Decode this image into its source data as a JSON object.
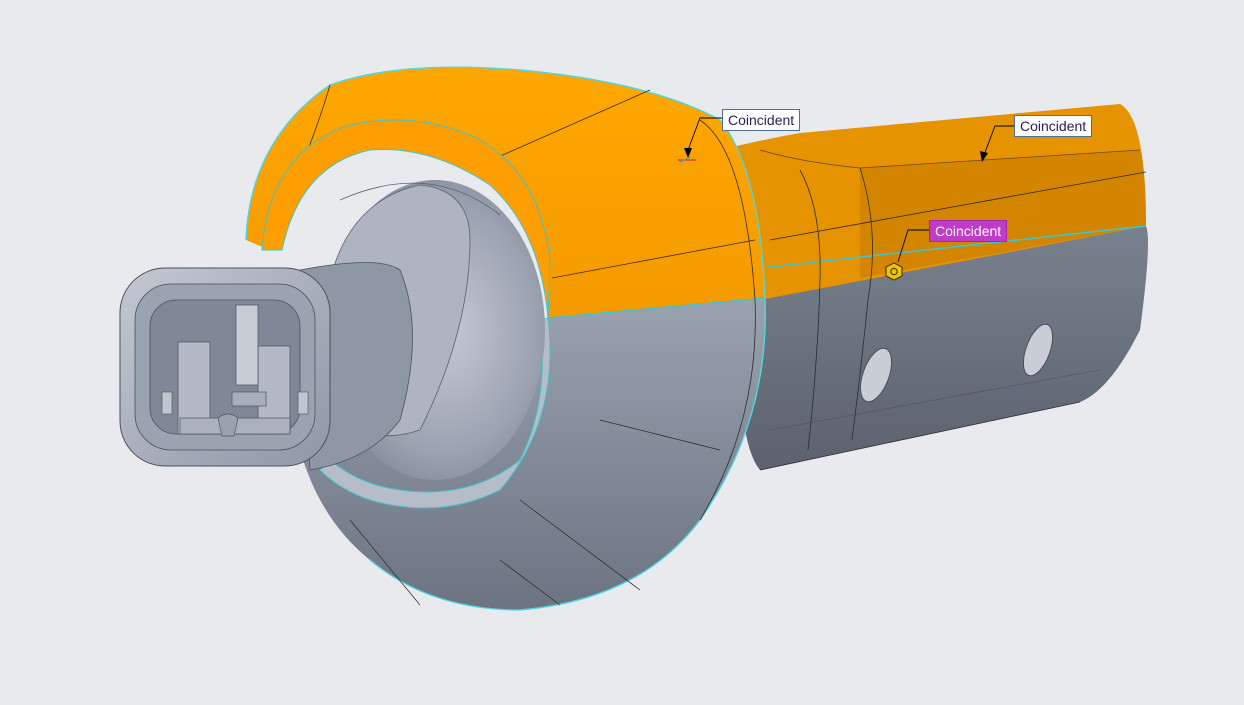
{
  "viewport": {
    "background": "#e9eaee",
    "model_colors": {
      "orange_face": "#ffa500",
      "orange_shade": "#e28c00",
      "gray_face": "#8d96a5",
      "gray_shade": "#6b7380",
      "edge_highlight": "#4fd6e0"
    }
  },
  "constraints": [
    {
      "label": "Coincident",
      "state": "normal"
    },
    {
      "label": "Coincident",
      "state": "normal"
    },
    {
      "label": "Coincident",
      "state": "selected"
    }
  ],
  "constraint_marker_icon": "hexagon-nut-icon"
}
